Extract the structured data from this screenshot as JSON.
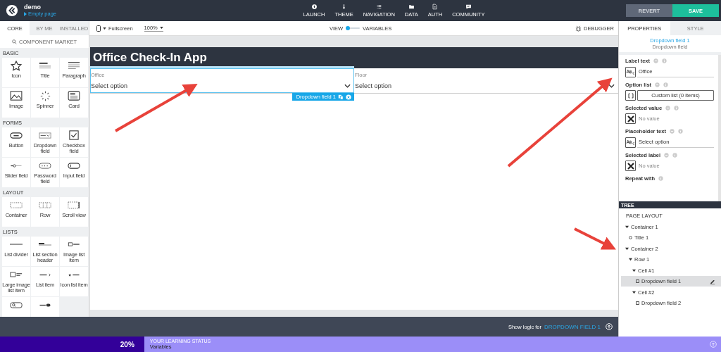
{
  "topbar": {
    "project": "demo",
    "page": "Empty page",
    "nav": [
      {
        "label": "LAUNCH"
      },
      {
        "label": "THEME"
      },
      {
        "label": "NAVIGATION"
      },
      {
        "label": "DATA"
      },
      {
        "label": "AUTH"
      },
      {
        "label": "COMMUNITY"
      }
    ],
    "buttons": [
      {
        "label": "REVERT",
        "kind": "secondary"
      },
      {
        "label": "SAVE",
        "kind": "primary"
      }
    ]
  },
  "palette": {
    "tabs": [
      {
        "label": "CORE",
        "selected": true
      },
      {
        "label": "BY ME",
        "selected": false
      },
      {
        "label": "INSTALLED",
        "selected": false
      }
    ],
    "market": "COMPONENT MARKET",
    "sections": [
      {
        "title": "BASIC",
        "items": [
          {
            "label": "Icon",
            "kind": "star"
          },
          {
            "label": "Title",
            "kind": "title"
          },
          {
            "label": "Paragraph",
            "kind": "para"
          },
          {
            "label": "Image",
            "kind": "image"
          },
          {
            "label": "Spinner",
            "kind": "spinner"
          },
          {
            "label": "Card",
            "kind": "card"
          }
        ]
      },
      {
        "title": "FORMS",
        "items": [
          {
            "label": "Button",
            "kind": "button"
          },
          {
            "label": "Dropdown field",
            "kind": "dropdown"
          },
          {
            "label": "Checkbox field",
            "kind": "checkbox"
          },
          {
            "label": "Slider field",
            "kind": "slider"
          },
          {
            "label": "Password field",
            "kind": "password"
          },
          {
            "label": "Input field",
            "kind": "input"
          }
        ]
      },
      {
        "title": "LAYOUT",
        "items": [
          {
            "label": "Container",
            "kind": "container"
          },
          {
            "label": "Row",
            "kind": "row"
          },
          {
            "label": "Scroll view",
            "kind": "scroll"
          }
        ]
      },
      {
        "title": "LISTS",
        "items": [
          {
            "label": "List divider",
            "kind": "divider"
          },
          {
            "label": "List section header",
            "kind": "sectionheader"
          },
          {
            "label": "Image list item",
            "kind": "imagelist"
          },
          {
            "label": "Large image list item",
            "kind": "largeimagelist"
          },
          {
            "label": "List item",
            "kind": "listitem"
          },
          {
            "label": "Icon list item",
            "kind": "iconlist"
          },
          {
            "kind": "search"
          },
          {
            "kind": "toggle"
          }
        ]
      }
    ]
  },
  "toolbar": {
    "device": "Fullscreen",
    "zoom": "100%",
    "view": "VIEW",
    "variables": "VARIABLES",
    "debugger": "DEBUGGER"
  },
  "canvas": {
    "title": "Office Check-In App",
    "fields": [
      {
        "label": "Office",
        "placeholder": "Select option",
        "selected": true
      },
      {
        "label": "Floor",
        "placeholder": "Select option",
        "selected": false
      }
    ],
    "tag": "Dropdown field 1"
  },
  "logic": {
    "prefix": "Show logic for",
    "target": "DROPDOWN FIELD 1"
  },
  "properties": {
    "tabs": [
      {
        "label": "PROPERTIES",
        "selected": true
      },
      {
        "label": "STYLE",
        "selected": false
      }
    ],
    "name": "Dropdown field 1",
    "type": "Dropdown field",
    "props": [
      {
        "label": "Label text",
        "kind": "text",
        "value": "Office"
      },
      {
        "label": "Option list",
        "kind": "list",
        "value": "Custom list (0 items)"
      },
      {
        "label": "Selected value",
        "kind": "empty",
        "value": "No value"
      },
      {
        "label": "Placeholder text",
        "kind": "text",
        "value": "Select option"
      },
      {
        "label": "Selected label",
        "kind": "empty",
        "value": "No value"
      },
      {
        "label": "Repeat with",
        "kind": "none"
      }
    ]
  },
  "tree": {
    "title": "TREE",
    "heading": "PAGE LAYOUT",
    "nodes": [
      {
        "label": "Container 1",
        "kind": "group",
        "expanded": true,
        "selected": false,
        "children": [
          {
            "label": "Title 1",
            "kind": "text",
            "selected": false
          }
        ]
      },
      {
        "label": "Container 2",
        "kind": "group",
        "expanded": true,
        "selected": false,
        "children": [
          {
            "label": "Row 1",
            "kind": "group",
            "expanded": true,
            "selected": false,
            "children": [
              {
                "label": "Cell #1",
                "kind": "group",
                "expanded": true,
                "selected": false,
                "children": [
                  {
                    "label": "Dropdown field 1",
                    "kind": "field",
                    "selected": true
                  }
                ]
              },
              {
                "label": "Cell #2",
                "kind": "group",
                "expanded": true,
                "selected": false,
                "children": [
                  {
                    "label": "Dropdown field 2",
                    "kind": "field",
                    "selected": false
                  }
                ]
              }
            ]
          }
        ]
      }
    ]
  },
  "learning": {
    "percent": "20%",
    "level": 0.2,
    "heading": "YOUR LEARNING STATUS",
    "topic": "Variables"
  }
}
